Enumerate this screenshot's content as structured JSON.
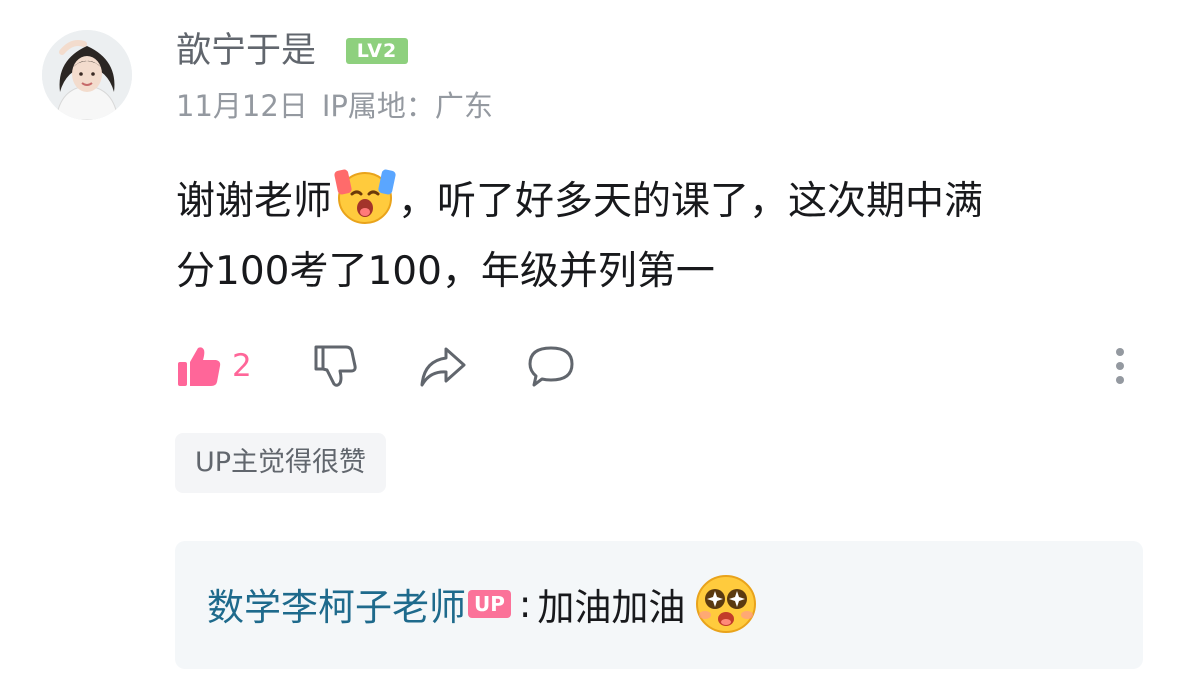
{
  "comment": {
    "username": "歆宁于是",
    "level_badge": "LV2",
    "date": "11月12日",
    "ip_location": "IP属地：广东",
    "text_part1": "谢谢老师",
    "emoji_inline": "crying-face-emoji",
    "text_part2": "，听了好多天的课了，这次期中满",
    "text_line2": "分100考了100，年级并列第一",
    "like_count": "2",
    "up_liked": "UP主觉得很赞"
  },
  "reply": {
    "author": "数学李柯子老师",
    "up_tag": "UP",
    "colon": ":",
    "text": "加油加油",
    "emoji": "starry-eyed-emoji"
  },
  "colors": {
    "like_pink": "#ff6699",
    "level_green": "#8ed07e",
    "reply_author_blue": "#1e6a8c",
    "up_tag_pink": "#fb7299"
  }
}
